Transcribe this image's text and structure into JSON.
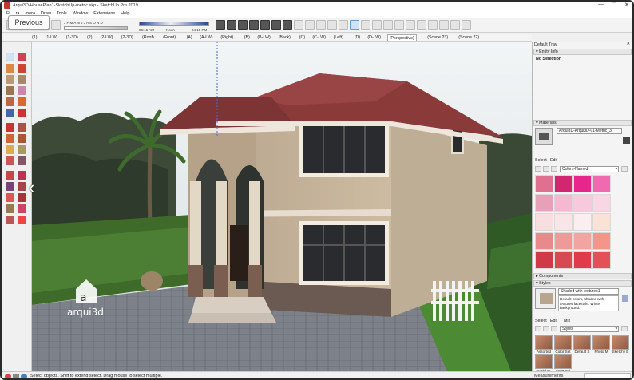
{
  "window": {
    "title": "Arqui3D-HousePlan1-SketchUp-metric.skp - SketchUp Pro 2019",
    "minimize": "—",
    "maximize": "☐",
    "close": "✕"
  },
  "menu": [
    "File",
    "Edit",
    "View",
    "Camera",
    "Draw",
    "Tools",
    "Window",
    "Extensions",
    "Help"
  ],
  "menu_visible": [
    "Fi",
    "ra",
    "mera",
    "Draw",
    "Tools",
    "Window",
    "Extensions",
    "Help"
  ],
  "overlay": {
    "previous_button": "Previous",
    "prev_arrow": "‹"
  },
  "shadows": {
    "months": "J F M A M J J A S O N D",
    "time_start": "06:15 AM",
    "time_mid": "Noon",
    "time_end": "04:15 PM"
  },
  "scenes": [
    "(1)",
    "(1-LW)",
    "(1-3D)",
    "(2)",
    "(2-LW)",
    "(2-3D)",
    "(Roof)",
    "(Front)",
    "(A)",
    "(A-LW)",
    "(Right)",
    "(B)",
    "(B-LW)",
    "(Back)",
    "(C)",
    "(C-LW)",
    "(Left)",
    "(D)",
    "(D-LW)",
    "(Perspective)",
    "(Scene 23)",
    "(Scene 22)"
  ],
  "scenes_active": "(Perspective)",
  "viewport": {
    "watermark_logo": "a",
    "watermark_text": "arqui3d"
  },
  "tray": {
    "title": "Default Tray",
    "entity_info": {
      "header": "Entity Info",
      "value": "No Selection"
    },
    "materials": {
      "header": "Materials",
      "name_value": "Arqui3D-Arqui3D-01-Metric_3",
      "tab_select": "Select",
      "tab_edit": "Edit",
      "library": "Colors-Named",
      "swatches": [
        "#e0708f",
        "#d22670",
        "#e8258a",
        "#f06ab0",
        "#e8a0b8",
        "#f4b8d0",
        "#f8c8dc",
        "#f9d6e4",
        "#f8dede",
        "#f9e4e8",
        "#fbeef0",
        "#fae2d6",
        "#e88a8a",
        "#ee9a98",
        "#f2a4a0",
        "#f4948a",
        "#d03a48",
        "#d84a52",
        "#e03b4a",
        "#e25058"
      ]
    },
    "components": {
      "header": "Components"
    },
    "styles": {
      "header": "Styles",
      "name_value": "Shaded with textures1",
      "description": "Default colors, shaded with textures facestyle. White background.",
      "tab_select": "Select",
      "tab_edit": "Edit",
      "tab_mix": "Mix",
      "library": "Styles",
      "items": [
        "Assorted",
        "Color Set",
        "Default S",
        "Photo M",
        "Sketchy E",
        "Straight L",
        "Style Bui"
      ]
    }
  },
  "status": {
    "text": "Select objects. Shift to extend select. Drag mouse to select multiple.",
    "measurements_label": "Measurements"
  },
  "colors": {
    "roof": "#8b3a3a",
    "wall": "#c9b59b",
    "sky": "#dfe6ea",
    "accent": "#c0392b"
  }
}
